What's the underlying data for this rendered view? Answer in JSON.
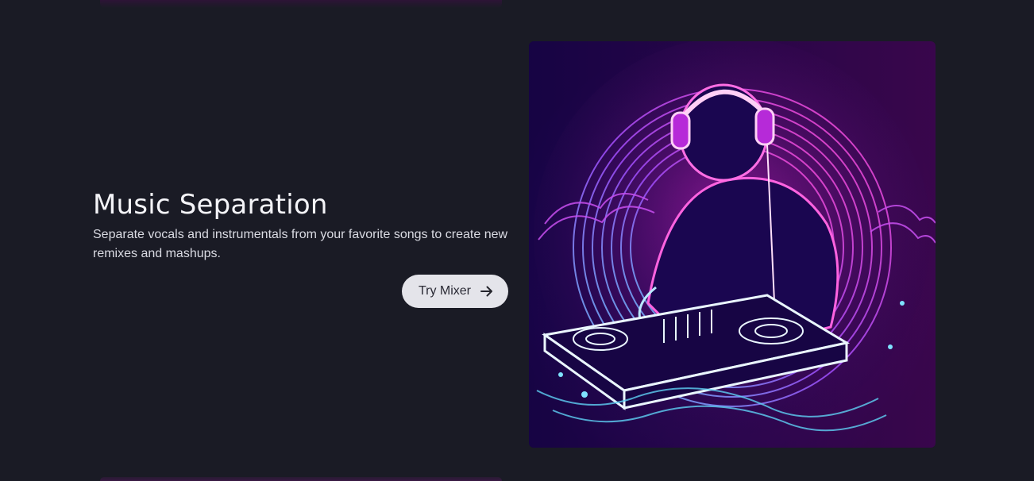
{
  "feature": {
    "title": "Music Separation",
    "description": "Separate vocals and instrumentals from your favorite songs to create new remixes and mashups.",
    "cta_label": "Try Mixer",
    "cta_icon": "arrow-right-icon"
  },
  "image": {
    "subject": "dj-illustration",
    "colors": {
      "magenta": "#e23bd6",
      "violet": "#7b3cf0",
      "cyan": "#5fd1f5",
      "deep": "#12033a"
    }
  },
  "theme": {
    "background": "#1a1b25",
    "button_bg": "#e4e4ea",
    "button_text": "#2a2a35"
  }
}
